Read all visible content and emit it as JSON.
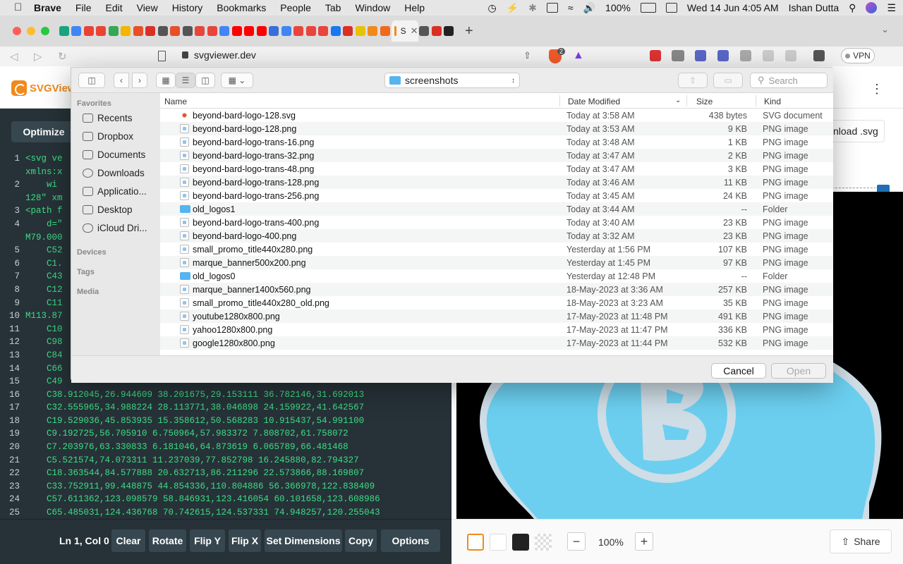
{
  "menubar": {
    "app_name": "Brave",
    "items": [
      "File",
      "Edit",
      "View",
      "History",
      "Bookmarks",
      "People",
      "Tab",
      "Window",
      "Help"
    ],
    "battery": "100%",
    "datetime": "Wed 14 Jun  4:05 AM",
    "user": "Ishan Dutta"
  },
  "browser": {
    "active_tab_label": "S",
    "url": "svgviewer.dev",
    "vpn_label": "VPN",
    "shields_count": "2"
  },
  "app": {
    "logo_text": "SVGView",
    "optimize_label": "Optimize",
    "download_label": "nload .svg",
    "code_lines": [
      {
        "n": "1",
        "t": "<svg ve"
      },
      {
        "n": "",
        "t": "xmlns:x"
      },
      {
        "n": "2",
        "t": "    wi"
      },
      {
        "n": "",
        "t": "128\" xm"
      },
      {
        "n": "3",
        "t": "<path f"
      },
      {
        "n": "4",
        "t": "    d=\""
      },
      {
        "n": "",
        "t": "M79.000"
      },
      {
        "n": "5",
        "t": "    C52"
      },
      {
        "n": "6",
        "t": "    C1."
      },
      {
        "n": "7",
        "t": "    C43"
      },
      {
        "n": "8",
        "t": "    C12"
      },
      {
        "n": "9",
        "t": "    C11"
      },
      {
        "n": "10",
        "t": "M113.87"
      },
      {
        "n": "11",
        "t": "    C10"
      },
      {
        "n": "12",
        "t": "    C98"
      },
      {
        "n": "13",
        "t": "    C84"
      },
      {
        "n": "14",
        "t": "    C66"
      },
      {
        "n": "15",
        "t": "    C49"
      },
      {
        "n": "16",
        "t": "    C38.912045,26.944609 38.201675,29.153111 36.782146,31.692013"
      },
      {
        "n": "17",
        "t": "    C32.555965,34.988224 28.113771,38.046898 24.159922,41.642567"
      },
      {
        "n": "18",
        "t": "    C19.529036,45.853935 15.358612,50.568283 10.915437,54.991100"
      },
      {
        "n": "19",
        "t": "    C9.192725,56.705910 6.750964,57.983372 7.808702,61.758072"
      },
      {
        "n": "20",
        "t": "    C7.203976,63.330833 6.181046,64.873619 6.065789,66.481468"
      },
      {
        "n": "21",
        "t": "    C5.521574,74.073311 11.237039,77.852798 16.245880,82.794327"
      },
      {
        "n": "22",
        "t": "    C18.363544,84.577888 20.632713,86.211296 22.573866,88.169807"
      },
      {
        "n": "23",
        "t": "    C33.752911,99.448875 44.854336,110.804886 56.366978,122.838409"
      },
      {
        "n": "24",
        "t": "    C57.611362,123.098579 58.846931,123.416054 60.101658,123.608986"
      },
      {
        "n": "25",
        "t": "    C65.485031,124.436768 70.742615,124.537331 74.948257,120.255043"
      }
    ],
    "bottom_bar": {
      "position": "Ln 1, Col 0",
      "buttons": [
        "Clear",
        "Rotate",
        "Flip Y",
        "Flip X",
        "Set Dimensions",
        "Copy",
        "Options"
      ]
    },
    "zoom": "100%",
    "share_label": "Share",
    "colors": {
      "accent": "#f08a1c",
      "editor_bg": "#263238",
      "code_text": "#3ddc84",
      "logo_fill": "#6ccff0",
      "logo_inner": "#cfdde6"
    }
  },
  "dialog": {
    "location": "screenshots",
    "search_placeholder": "Search",
    "sidebar": {
      "favorites_header": "Favorites",
      "favorites": [
        "Recents",
        "Dropbox",
        "Documents",
        "Downloads",
        "Applicatio...",
        "Desktop",
        "iCloud Dri..."
      ],
      "devices_header": "Devices",
      "tags_header": "Tags",
      "media_header": "Media"
    },
    "columns": {
      "name": "Name",
      "date": "Date Modified",
      "size": "Size",
      "kind": "Kind"
    },
    "files": [
      {
        "name": "beyond-bard-logo-128.svg",
        "date": "Today at 3:58 AM",
        "size": "438 bytes",
        "kind": "SVG document",
        "icon": "svg"
      },
      {
        "name": "beyond-bard-logo-128.png",
        "date": "Today at 3:53 AM",
        "size": "9 KB",
        "kind": "PNG image",
        "icon": "png"
      },
      {
        "name": "beyond-bard-logo-trans-16.png",
        "date": "Today at 3:48 AM",
        "size": "1 KB",
        "kind": "PNG image",
        "icon": "png"
      },
      {
        "name": "beyond-bard-logo-trans-32.png",
        "date": "Today at 3:47 AM",
        "size": "2 KB",
        "kind": "PNG image",
        "icon": "png"
      },
      {
        "name": "beyond-bard-logo-trans-48.png",
        "date": "Today at 3:47 AM",
        "size": "3 KB",
        "kind": "PNG image",
        "icon": "png"
      },
      {
        "name": "beyond-bard-logo-trans-128.png",
        "date": "Today at 3:46 AM",
        "size": "11 KB",
        "kind": "PNG image",
        "icon": "png"
      },
      {
        "name": "beyond-bard-logo-trans-256.png",
        "date": "Today at 3:45 AM",
        "size": "24 KB",
        "kind": "PNG image",
        "icon": "png"
      },
      {
        "name": "old_logos1",
        "date": "Today at 3:44 AM",
        "size": "--",
        "kind": "Folder",
        "icon": "fold"
      },
      {
        "name": "beyond-bard-logo-trans-400.png",
        "date": "Today at 3:40 AM",
        "size": "23 KB",
        "kind": "PNG image",
        "icon": "png"
      },
      {
        "name": "beyond-bard-logo-400.png",
        "date": "Today at 3:32 AM",
        "size": "23 KB",
        "kind": "PNG image",
        "icon": "png"
      },
      {
        "name": "small_promo_title440x280.png",
        "date": "Yesterday at 1:56 PM",
        "size": "107 KB",
        "kind": "PNG image",
        "icon": "png"
      },
      {
        "name": "marque_banner500x200.png",
        "date": "Yesterday at 1:45 PM",
        "size": "97 KB",
        "kind": "PNG image",
        "icon": "png"
      },
      {
        "name": "old_logos0",
        "date": "Yesterday at 12:48 PM",
        "size": "--",
        "kind": "Folder",
        "icon": "fold"
      },
      {
        "name": "marque_banner1400x560.png",
        "date": "18-May-2023 at 3:36 AM",
        "size": "257 KB",
        "kind": "PNG image",
        "icon": "png"
      },
      {
        "name": "small_promo_title440x280_old.png",
        "date": "18-May-2023 at 3:23 AM",
        "size": "35 KB",
        "kind": "PNG image",
        "icon": "png"
      },
      {
        "name": "youtube1280x800.png",
        "date": "17-May-2023 at 11:48 PM",
        "size": "491 KB",
        "kind": "PNG image",
        "icon": "png"
      },
      {
        "name": "yahoo1280x800.png",
        "date": "17-May-2023 at 11:47 PM",
        "size": "336 KB",
        "kind": "PNG image",
        "icon": "png"
      },
      {
        "name": "google1280x800.png",
        "date": "17-May-2023 at 11:44 PM",
        "size": "532 KB",
        "kind": "PNG image",
        "icon": "png"
      }
    ],
    "cancel_label": "Cancel",
    "open_label": "Open"
  }
}
